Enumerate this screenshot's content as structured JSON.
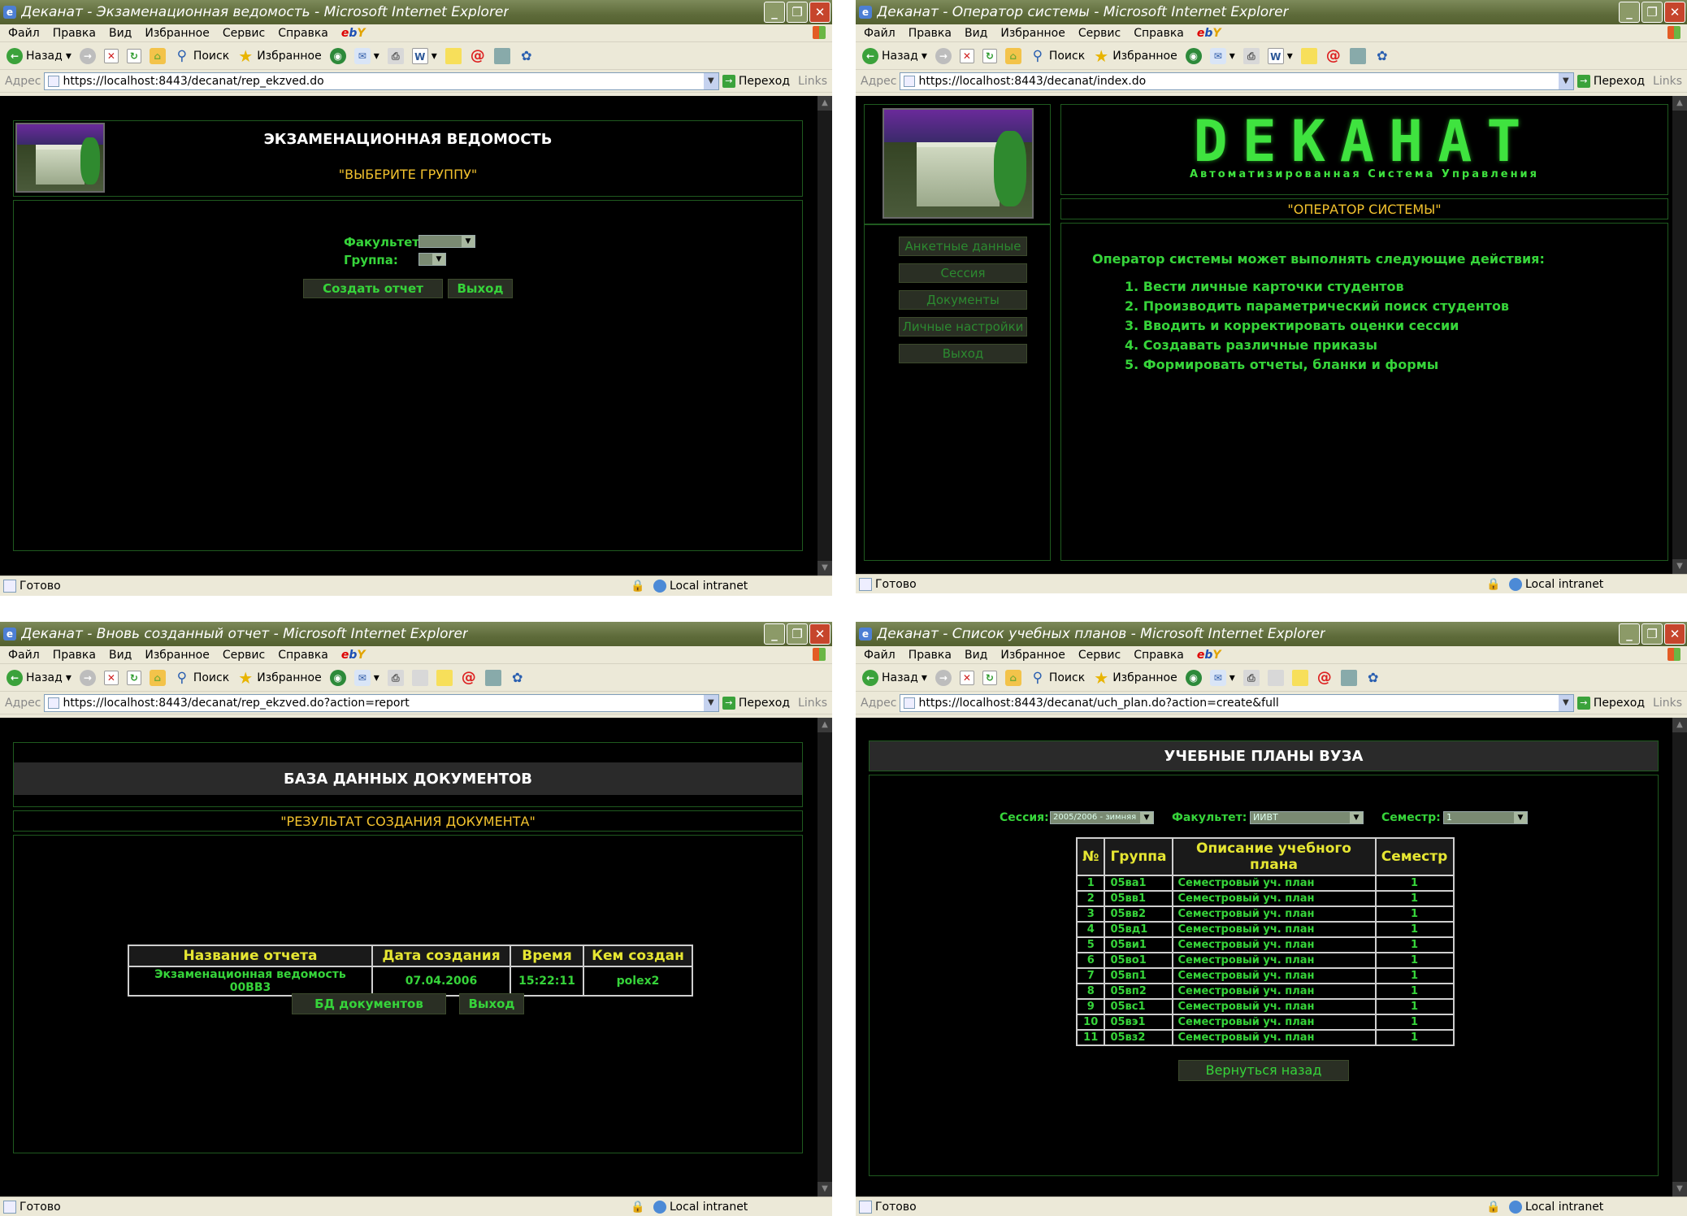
{
  "window1": {
    "title": "Деканат - Экзаменационная ведомость - Microsoft Internet Explorer",
    "address": "https://localhost:8443/decanat/rep_ekzved.do",
    "heading": "ЭКЗАМЕНАЦИОННАЯ ВЕДОМОСТЬ",
    "subheading": "\"ВЫБЕРИТЕ ГРУППУ\"",
    "faculty_label": "Факультет:",
    "group_label": "Группа:",
    "create_btn": "Создать отчет",
    "exit_btn": "Выход",
    "status": "Готово"
  },
  "window2": {
    "title": "Деканат - Оператор системы - Microsoft Internet Explorer",
    "address": "https://localhost:8443/decanat/index.do",
    "logo_title": "DEKAHAT",
    "logo_sub": "Автоматизированная Система Управления",
    "role": "\"ОПЕРАТОР СИСТЕМЫ\"",
    "menu": [
      "Анкетные данные",
      "Сессия",
      "Документы",
      "Личные настройки",
      "Выход"
    ],
    "intro": "Оператор системы может выполнять следующие действия:",
    "actions": [
      "1. Вести личные карточки студентов",
      "2. Производить параметрический поиск студентов",
      "3. Вводить и корректировать оценки сессии",
      "4. Создавать различные приказы",
      "5. Формировать отчеты, бланки и формы"
    ],
    "status": "Готово"
  },
  "window3": {
    "title": "Деканат - Вновь созданный отчет - Microsoft Internet Explorer",
    "address": "https://localhost:8443/decanat/rep_ekzved.do?action=report",
    "heading": "БАЗА ДАННЫХ ДОКУМЕНТОВ",
    "subheading": "\"РЕЗУЛЬТАТ СОЗДАНИЯ ДОКУМЕНТА\"",
    "table_headers": [
      "Название отчета",
      "Дата создания",
      "Время",
      "Кем создан"
    ],
    "table_row": [
      "Экзаменационная ведомость 00ВВ3",
      "07.04.2006",
      "15:22:11",
      "polex2"
    ],
    "db_btn": "БД документов",
    "exit_btn": "Выход",
    "status": "Готово"
  },
  "window4": {
    "title": "Деканат - Список учебных планов - Microsoft Internet Explorer",
    "address": "https://localhost:8443/decanat/uch_plan.do?action=create&full",
    "heading": "УЧЕБНЫЕ ПЛАНЫ ВУЗА",
    "session_label": "Сессия:",
    "session_value": "2005/2006 - зимняя",
    "faculty_label": "Факультет:",
    "faculty_value": "ИИВТ",
    "semester_label": "Семестр:",
    "semester_value": "1",
    "table_headers": [
      "№",
      "Группа",
      "Описание учебного плана",
      "Семестр"
    ],
    "rows": [
      [
        "1",
        "05ва1",
        "Семестровый уч. план",
        "1"
      ],
      [
        "2",
        "05вв1",
        "Семестровый уч. план",
        "1"
      ],
      [
        "3",
        "05вв2",
        "Семестровый уч. план",
        "1"
      ],
      [
        "4",
        "05вд1",
        "Семестровый уч. план",
        "1"
      ],
      [
        "5",
        "05ви1",
        "Семестровый уч. план",
        "1"
      ],
      [
        "6",
        "05во1",
        "Семестровый уч. план",
        "1"
      ],
      [
        "7",
        "05вп1",
        "Семестровый уч. план",
        "1"
      ],
      [
        "8",
        "05вп2",
        "Семестровый уч. план",
        "1"
      ],
      [
        "9",
        "05вс1",
        "Семестровый уч. план",
        "1"
      ],
      [
        "10",
        "05вэ1",
        "Семестровый уч. план",
        "1"
      ],
      [
        "11",
        "05вз2",
        "Семестровый уч. план",
        "1"
      ]
    ],
    "back_btn": "Вернуться назад",
    "status": "Готово"
  },
  "ie": {
    "menu": [
      "Файл",
      "Правка",
      "Вид",
      "Избранное",
      "Сервис",
      "Справка"
    ],
    "back": "Назад",
    "search": "Поиск",
    "favorites": "Избранное",
    "address_label": "Адрес",
    "go": "Переход",
    "links": "Links",
    "zone": "Local intranet"
  }
}
